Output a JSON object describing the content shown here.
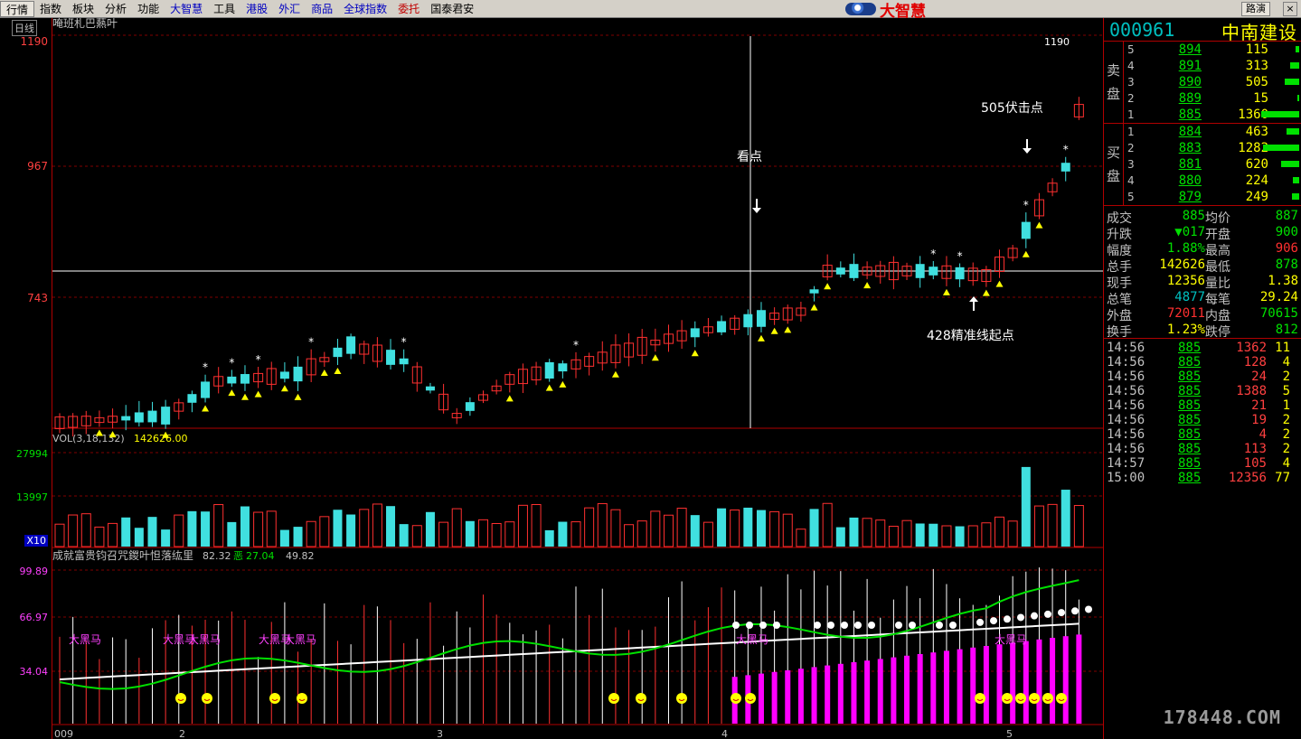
{
  "menu": [
    "行情",
    "指数",
    "板块",
    "分析",
    "功能",
    "大智慧",
    "工具",
    "港股",
    "外汇",
    "商品",
    "全球指数",
    "委托",
    "国泰君安"
  ],
  "brand": "大智慧",
  "menu_right": "路演",
  "close_label": "×",
  "colors": {
    "up": "#ff3030",
    "down": "#40e0e0",
    "grid": "#800000",
    "accent": "#ffff00",
    "magenta": "#ff00ff"
  },
  "period": "日线",
  "chart_title": "唵班札巴爇叶",
  "price_axis": [
    "1190",
    "967",
    "743"
  ],
  "vol_title": "VOL(3,18,132)",
  "vol_value": "142626.00",
  "vol_axis": [
    "27994",
    "13997"
  ],
  "vol_mult": "X10",
  "ind_title": "成就富贵钧召咒鍐叶怛落纮里",
  "ind_v1": "82.32",
  "ind_k2": "恶",
  "ind_v2": "27.04",
  "ind_v3": "49.82",
  "ind_axis": [
    "99.89",
    "66.97",
    "34.04"
  ],
  "annotations": {
    "kandian": "看点",
    "fujidian": "505伏击点",
    "jingzhun": "428精准线起点",
    "peak_value": "1190"
  },
  "date_labels": [
    "009",
    "2",
    "3",
    "4",
    "5"
  ],
  "dahema": "大黑马",
  "stock": {
    "code": "000961",
    "name": "中南建设"
  },
  "sell_label": [
    "卖",
    "盘"
  ],
  "buy_label": [
    "买",
    "盘"
  ],
  "sell": [
    {
      "lvl": "5",
      "price": "894",
      "vol": "115",
      "bar": 4
    },
    {
      "lvl": "4",
      "price": "891",
      "vol": "313",
      "bar": 10
    },
    {
      "lvl": "3",
      "price": "890",
      "vol": "505",
      "bar": 16
    },
    {
      "lvl": "2",
      "price": "889",
      "vol": "15",
      "bar": 2
    },
    {
      "lvl": "1",
      "price": "885",
      "vol": "1360",
      "bar": 42
    }
  ],
  "buy": [
    {
      "lvl": "1",
      "price": "884",
      "vol": "463",
      "bar": 14
    },
    {
      "lvl": "2",
      "price": "883",
      "vol": "1282",
      "bar": 40
    },
    {
      "lvl": "3",
      "price": "881",
      "vol": "620",
      "bar": 20
    },
    {
      "lvl": "4",
      "price": "880",
      "vol": "224",
      "bar": 7
    },
    {
      "lvl": "5",
      "price": "879",
      "vol": "249",
      "bar": 8
    }
  ],
  "stats": [
    {
      "k1": "成交",
      "v1": "885",
      "c1": "#00e000",
      "k2": "均价",
      "v2": "887",
      "c2": "#00e000"
    },
    {
      "k1": "升跌",
      "v1": "▼017",
      "c1": "#00e000",
      "k2": "开盘",
      "v2": "900",
      "c2": "#00e000"
    },
    {
      "k1": "幅度",
      "v1": "1.88%",
      "c1": "#00e000",
      "k2": "最高",
      "v2": "906",
      "c2": "#ff3030"
    },
    {
      "k1": "总手",
      "v1": "142626",
      "c1": "#ffff00",
      "k2": "最低",
      "v2": "878",
      "c2": "#00e000"
    },
    {
      "k1": "现手",
      "v1": "12356",
      "c1": "#ffff00",
      "k2": "量比",
      "v2": "1.38",
      "c2": "#ffff00"
    },
    {
      "k1": "总笔",
      "v1": "4877",
      "c1": "#00c0c0",
      "k2": "每笔",
      "v2": "29.24",
      "c2": "#ffff00"
    },
    {
      "k1": "外盘",
      "v1": "72011",
      "c1": "#ff3030",
      "k2": "内盘",
      "v2": "70615",
      "c2": "#00e000"
    },
    {
      "k1": "换手",
      "v1": "1.23%",
      "c1": "#ffff00",
      "k2": "跌停",
      "v2": "812",
      "c2": "#00e000"
    }
  ],
  "ticks": [
    {
      "t": "14:56",
      "p": "885",
      "v": "1362",
      "n": "11"
    },
    {
      "t": "14:56",
      "p": "885",
      "v": "128",
      "n": "4"
    },
    {
      "t": "14:56",
      "p": "885",
      "v": "24",
      "n": "2"
    },
    {
      "t": "14:56",
      "p": "885",
      "v": "1388",
      "n": "5"
    },
    {
      "t": "14:56",
      "p": "885",
      "v": "21",
      "n": "1"
    },
    {
      "t": "14:56",
      "p": "885",
      "v": "19",
      "n": "2"
    },
    {
      "t": "14:56",
      "p": "885",
      "v": "4",
      "n": "2"
    },
    {
      "t": "14:56",
      "p": "885",
      "v": "113",
      "n": "2"
    },
    {
      "t": "14:57",
      "p": "885",
      "v": "105",
      "n": "4"
    },
    {
      "t": "15:00",
      "p": "885",
      "v": "12356",
      "n": "77"
    }
  ],
  "watermark": "178448.COM"
}
